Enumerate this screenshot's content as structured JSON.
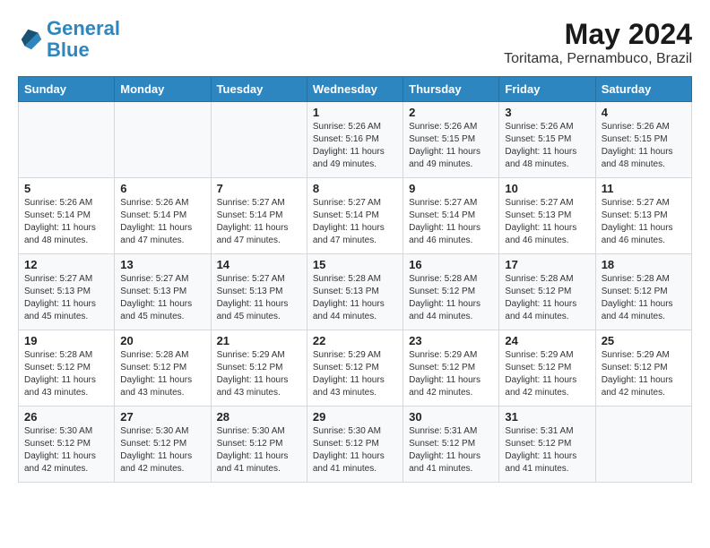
{
  "header": {
    "logo_line1": "General",
    "logo_line2": "Blue",
    "month_year": "May 2024",
    "location": "Toritama, Pernambuco, Brazil"
  },
  "weekdays": [
    "Sunday",
    "Monday",
    "Tuesday",
    "Wednesday",
    "Thursday",
    "Friday",
    "Saturday"
  ],
  "weeks": [
    [
      {
        "day": "",
        "info": ""
      },
      {
        "day": "",
        "info": ""
      },
      {
        "day": "",
        "info": ""
      },
      {
        "day": "1",
        "info": "Sunrise: 5:26 AM\nSunset: 5:16 PM\nDaylight: 11 hours\nand 49 minutes."
      },
      {
        "day": "2",
        "info": "Sunrise: 5:26 AM\nSunset: 5:15 PM\nDaylight: 11 hours\nand 49 minutes."
      },
      {
        "day": "3",
        "info": "Sunrise: 5:26 AM\nSunset: 5:15 PM\nDaylight: 11 hours\nand 48 minutes."
      },
      {
        "day": "4",
        "info": "Sunrise: 5:26 AM\nSunset: 5:15 PM\nDaylight: 11 hours\nand 48 minutes."
      }
    ],
    [
      {
        "day": "5",
        "info": "Sunrise: 5:26 AM\nSunset: 5:14 PM\nDaylight: 11 hours\nand 48 minutes."
      },
      {
        "day": "6",
        "info": "Sunrise: 5:26 AM\nSunset: 5:14 PM\nDaylight: 11 hours\nand 47 minutes."
      },
      {
        "day": "7",
        "info": "Sunrise: 5:27 AM\nSunset: 5:14 PM\nDaylight: 11 hours\nand 47 minutes."
      },
      {
        "day": "8",
        "info": "Sunrise: 5:27 AM\nSunset: 5:14 PM\nDaylight: 11 hours\nand 47 minutes."
      },
      {
        "day": "9",
        "info": "Sunrise: 5:27 AM\nSunset: 5:14 PM\nDaylight: 11 hours\nand 46 minutes."
      },
      {
        "day": "10",
        "info": "Sunrise: 5:27 AM\nSunset: 5:13 PM\nDaylight: 11 hours\nand 46 minutes."
      },
      {
        "day": "11",
        "info": "Sunrise: 5:27 AM\nSunset: 5:13 PM\nDaylight: 11 hours\nand 46 minutes."
      }
    ],
    [
      {
        "day": "12",
        "info": "Sunrise: 5:27 AM\nSunset: 5:13 PM\nDaylight: 11 hours\nand 45 minutes."
      },
      {
        "day": "13",
        "info": "Sunrise: 5:27 AM\nSunset: 5:13 PM\nDaylight: 11 hours\nand 45 minutes."
      },
      {
        "day": "14",
        "info": "Sunrise: 5:27 AM\nSunset: 5:13 PM\nDaylight: 11 hours\nand 45 minutes."
      },
      {
        "day": "15",
        "info": "Sunrise: 5:28 AM\nSunset: 5:13 PM\nDaylight: 11 hours\nand 44 minutes."
      },
      {
        "day": "16",
        "info": "Sunrise: 5:28 AM\nSunset: 5:12 PM\nDaylight: 11 hours\nand 44 minutes."
      },
      {
        "day": "17",
        "info": "Sunrise: 5:28 AM\nSunset: 5:12 PM\nDaylight: 11 hours\nand 44 minutes."
      },
      {
        "day": "18",
        "info": "Sunrise: 5:28 AM\nSunset: 5:12 PM\nDaylight: 11 hours\nand 44 minutes."
      }
    ],
    [
      {
        "day": "19",
        "info": "Sunrise: 5:28 AM\nSunset: 5:12 PM\nDaylight: 11 hours\nand 43 minutes."
      },
      {
        "day": "20",
        "info": "Sunrise: 5:28 AM\nSunset: 5:12 PM\nDaylight: 11 hours\nand 43 minutes."
      },
      {
        "day": "21",
        "info": "Sunrise: 5:29 AM\nSunset: 5:12 PM\nDaylight: 11 hours\nand 43 minutes."
      },
      {
        "day": "22",
        "info": "Sunrise: 5:29 AM\nSunset: 5:12 PM\nDaylight: 11 hours\nand 43 minutes."
      },
      {
        "day": "23",
        "info": "Sunrise: 5:29 AM\nSunset: 5:12 PM\nDaylight: 11 hours\nand 42 minutes."
      },
      {
        "day": "24",
        "info": "Sunrise: 5:29 AM\nSunset: 5:12 PM\nDaylight: 11 hours\nand 42 minutes."
      },
      {
        "day": "25",
        "info": "Sunrise: 5:29 AM\nSunset: 5:12 PM\nDaylight: 11 hours\nand 42 minutes."
      }
    ],
    [
      {
        "day": "26",
        "info": "Sunrise: 5:30 AM\nSunset: 5:12 PM\nDaylight: 11 hours\nand 42 minutes."
      },
      {
        "day": "27",
        "info": "Sunrise: 5:30 AM\nSunset: 5:12 PM\nDaylight: 11 hours\nand 42 minutes."
      },
      {
        "day": "28",
        "info": "Sunrise: 5:30 AM\nSunset: 5:12 PM\nDaylight: 11 hours\nand 41 minutes."
      },
      {
        "day": "29",
        "info": "Sunrise: 5:30 AM\nSunset: 5:12 PM\nDaylight: 11 hours\nand 41 minutes."
      },
      {
        "day": "30",
        "info": "Sunrise: 5:31 AM\nSunset: 5:12 PM\nDaylight: 11 hours\nand 41 minutes."
      },
      {
        "day": "31",
        "info": "Sunrise: 5:31 AM\nSunset: 5:12 PM\nDaylight: 11 hours\nand 41 minutes."
      },
      {
        "day": "",
        "info": ""
      }
    ]
  ]
}
